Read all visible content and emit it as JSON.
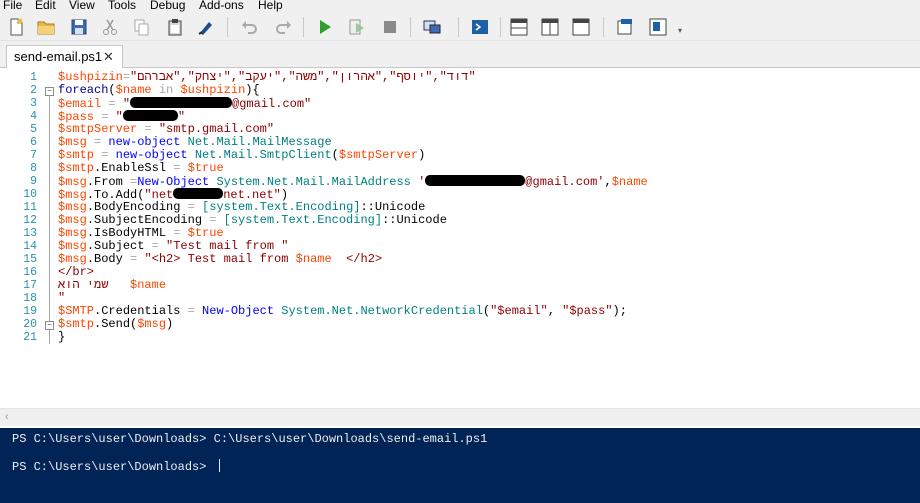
{
  "menu": [
    "File",
    "Edit",
    "View",
    "Tools",
    "Debug",
    "Add-ons",
    "Help"
  ],
  "toolbar": {
    "icons": [
      "new-file-icon",
      "open-folder-icon",
      "save-icon",
      "cut-icon",
      "copy-icon",
      "paste-icon",
      "clear-console-icon",
      "undo-icon",
      "redo-icon",
      "run-script-icon",
      "run-selection-icon",
      "stop-icon",
      "new-remote-tab-icon",
      "start-powershell-icon",
      "show-script-pane-top-icon",
      "show-script-pane-right-icon",
      "show-script-pane-maximized-icon",
      "show-command-window-icon",
      "show-command-addon-icon"
    ]
  },
  "tab": {
    "label": "send-email.ps1",
    "close": "✕"
  },
  "editor": {
    "line_numbers": [
      "1",
      "2",
      "3",
      "4",
      "5",
      "6",
      "7",
      "8",
      "9",
      "10",
      "11",
      "12",
      "13",
      "14",
      "15",
      "16",
      "17",
      "18",
      "19",
      "20",
      "21"
    ],
    "lines": {
      "l1_var": "$ushpizin",
      "l1_eq": "=",
      "l1_str": "\"דוד\",\"יוסף\",\"אהרון\",\"משה\",\"יעקב\",\"יצחק\",\"אברהם\"",
      "l2_kw": "foreach",
      "l2_open": "(",
      "l2_var1": "$name",
      "l2_in": " in ",
      "l2_var2": "$ushpizin",
      "l2_close": "){",
      "l3_var": "$email",
      "l3_eq": " = ",
      "l3_str_a": "\"",
      "l3_str_b": "@gmail.com\"",
      "l4_var": "$pass",
      "l4_eq": " = ",
      "l4_str_a": "\"",
      "l4_str_b": "\"",
      "l5_var": "$smtpServer",
      "l5_eq": " = ",
      "l5_str": "\"smtp.gmail.com\"",
      "l6_var": "$msg",
      "l6_eq": " = ",
      "l6_cmd": "new-object",
      "l6_type": " Net.Mail.MailMessage",
      "l7_var": "$smtp",
      "l7_eq": " = ",
      "l7_cmd": "new-object",
      "l7_type": " Net.Mail.SmtpClient",
      "l7_paren_o": "(",
      "l7_arg": "$smtpServer",
      "l7_paren_c": ")",
      "l8_var": "$smtp",
      "l8_prop": ".EnableSsl",
      "l8_eq": " = ",
      "l8_val": "$true",
      "l9_var": "$msg",
      "l9_prop": ".From ",
      "l9_eq": "=",
      "l9_cmd": "New-Object",
      "l9_type": " System.Net.Mail.MailAddress",
      "l9_sp": " ",
      "l9_str_a": "'",
      "l9_str_b": "@gmail.com'",
      "l9_comma": ",",
      "l9_arg": "$name",
      "l10_var": "$msg",
      "l10_prop": ".To.Add(",
      "l10_str_a": "\"net",
      "l10_str_b": "net.net\"",
      "l10_close": ")",
      "l11_var": "$msg",
      "l11_prop": ".BodyEncoding",
      "l11_eq": " = ",
      "l11_type": "[system.Text.Encoding]",
      "l11_rest": "::Unicode",
      "l12_var": "$msg",
      "l12_prop": ".SubjectEncoding",
      "l12_eq": " = ",
      "l12_type": "[system.Text.Encoding]",
      "l12_rest": "::Unicode",
      "l13_var": "$msg",
      "l13_prop": ".IsBodyHTML",
      "l13_eq": " = ",
      "l13_val": "$true",
      "l14_var": "$msg",
      "l14_prop": ".Subject",
      "l14_eq": " = ",
      "l14_str": "\"Test mail from \"",
      "l15_var": "$msg",
      "l15_prop": ".Body",
      "l15_eq": " = ",
      "l15_str_a": "\"<h2> Test mail from ",
      "l15_val": "$name",
      "l15_str_b": "  </h2>",
      "l16_str": "</br>",
      "l17_heb": "שמי הוא",
      "l17_var": "$name",
      "l18_str": "\"",
      "l19_var": "$SMTP",
      "l19_prop": ".Credentials",
      "l19_eq": " = ",
      "l19_cmd": "New-Object",
      "l19_type": " System.Net.NetworkCredential",
      "l19_o": "(",
      "l19_a1": "\"$email\"",
      "l19_comma": ", ",
      "l19_a2": "\"$pass\"",
      "l19_c": ");",
      "l20_var": "$smtp",
      "l20_prop": ".Send(",
      "l20_arg": "$msg",
      "l20_close": ")",
      "l21": "}"
    }
  },
  "console": {
    "line1": "PS C:\\Users\\user\\Downloads> C:\\Users\\user\\Downloads\\send-email.ps1",
    "line2": "PS C:\\Users\\user\\Downloads> "
  }
}
